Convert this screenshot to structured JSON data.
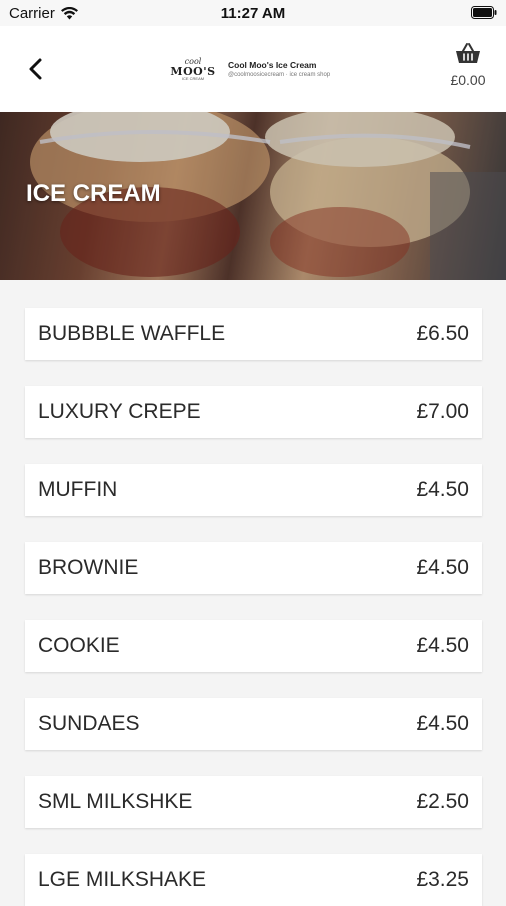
{
  "status_bar": {
    "carrier": "Carrier",
    "time": "11:27 AM"
  },
  "header": {
    "logo": {
      "line1": "cool",
      "line2": "MOO'S",
      "line3": "ICE CREAM",
      "name": "Cool Moo's Ice Cream",
      "tagline": "@coolmoosicecream · ice cream shop"
    },
    "basket_total": "£0.00"
  },
  "hero": {
    "title": "ICE CREAM"
  },
  "menu": {
    "items": [
      {
        "name": "BUBBBLE WAFFLE",
        "price": "£6.50"
      },
      {
        "name": "LUXURY CREPE",
        "price": "£7.00"
      },
      {
        "name": "MUFFIN",
        "price": "£4.50"
      },
      {
        "name": "BROWNIE",
        "price": "£4.50"
      },
      {
        "name": "COOKIE",
        "price": "£4.50"
      },
      {
        "name": "SUNDAES",
        "price": "£4.50"
      },
      {
        "name": "SML MILKSHKE",
        "price": "£2.50"
      },
      {
        "name": "LGE MILKSHAKE",
        "price": "£3.25"
      }
    ]
  }
}
